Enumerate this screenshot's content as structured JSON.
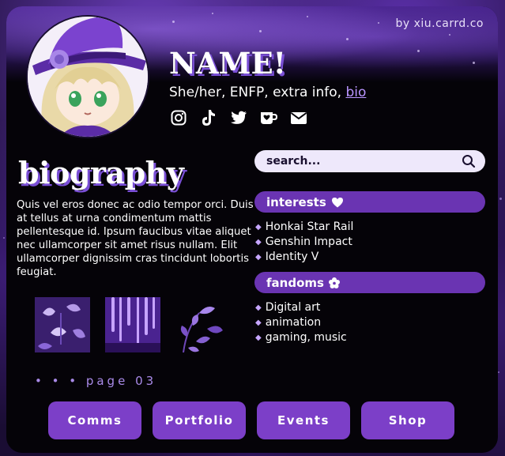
{
  "site": {
    "credit": "by xiu.carrd.co"
  },
  "profile": {
    "name": "NAME!",
    "tagline_prefix": "She/her, ENFP, extra info, ",
    "tagline_link": "bio",
    "socials": [
      "instagram-icon",
      "tiktok-icon",
      "twitter-icon",
      "kofi-icon",
      "mail-icon"
    ]
  },
  "bio": {
    "title": "biography",
    "text": "Quis vel eros donec ac odio tempor orci. Duis at tellus at urna condimentum mattis pellentesque id. Ipsum faucibus vitae aliquet nec ullamcorper sit amet risus nullam. Elit ullamcorper dignissim cras tincidunt lobortis feugiat."
  },
  "pager": {
    "label": "• • • page 03"
  },
  "search": {
    "placeholder": "search..."
  },
  "interests": {
    "label": "interests",
    "items": [
      "Honkai Star Rail",
      "Genshin Impact",
      "Identity V"
    ]
  },
  "fandoms": {
    "label": "fandoms",
    "items": [
      "Digital art",
      "animation",
      "gaming, music"
    ]
  },
  "buttons": {
    "comms": "Comms",
    "portfolio": "Portfolio",
    "events": "Events",
    "shop": "Shop"
  },
  "colors": {
    "accent": "#7c3fc8",
    "pill": "#6a34b2",
    "card_bg": "#050308",
    "link": "#b995ff"
  }
}
